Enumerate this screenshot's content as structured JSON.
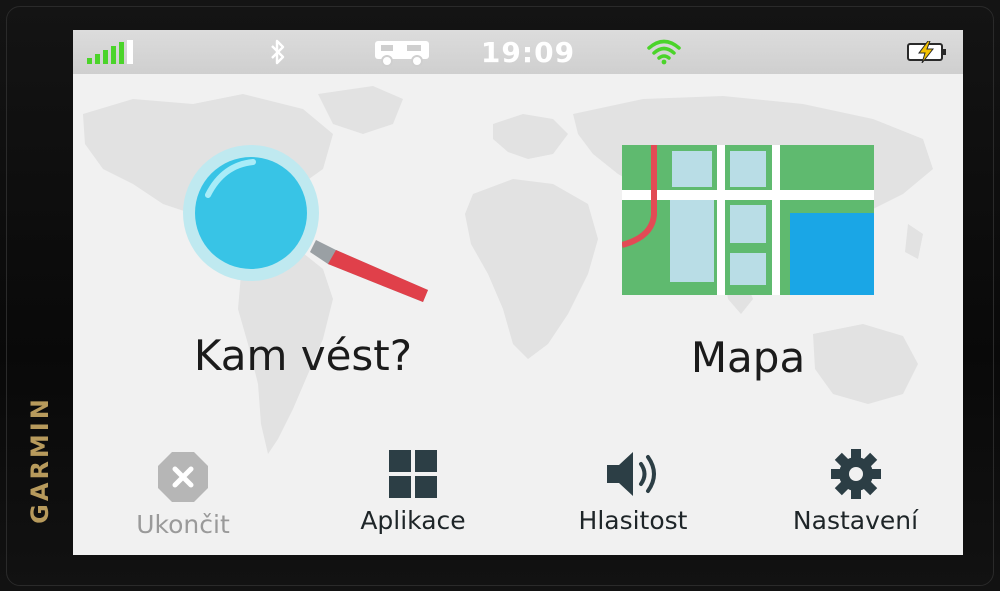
{
  "device": {
    "brand": "GARMIN"
  },
  "status_bar": {
    "time": "19:09",
    "signal_icon": "signal-bars-icon",
    "bluetooth_icon": "bluetooth-icon",
    "vehicle_icon": "camper-van-icon",
    "wifi_icon": "wifi-icon",
    "battery_icon": "battery-charging-icon",
    "accent_color": "#4bd42a"
  },
  "main_menu": {
    "search": {
      "label": "Kam vést?",
      "icon": "magnifier-icon"
    },
    "map": {
      "label": "Mapa",
      "icon": "map-icon"
    }
  },
  "bottom_bar": {
    "exit": {
      "label": "Ukončit",
      "icon": "close-octagon-icon",
      "enabled": false
    },
    "apps": {
      "label": "Aplikace",
      "icon": "apps-grid-icon"
    },
    "volume": {
      "label": "Hlasitost",
      "icon": "speaker-icon"
    },
    "settings": {
      "label": "Nastavení",
      "icon": "gear-icon"
    }
  }
}
